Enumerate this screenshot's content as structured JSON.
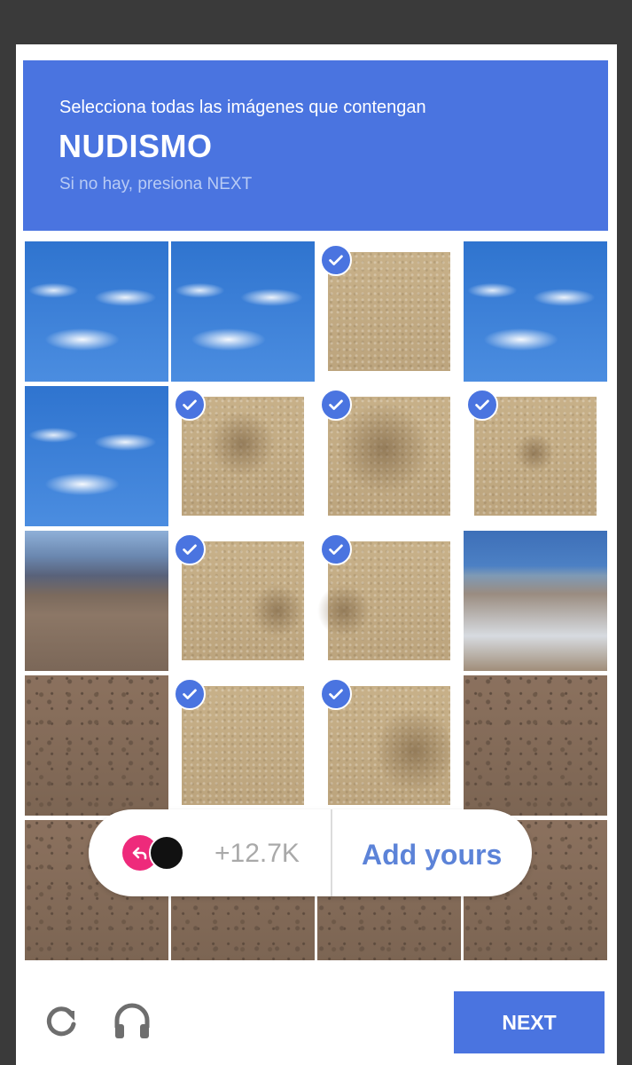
{
  "header": {
    "instruction": "Selecciona todas las imágenes que contengan",
    "keyword": "NUDISMO",
    "hint": "Si no hay, presiona NEXT"
  },
  "grid": {
    "selected_tiles": [
      3,
      6,
      7,
      8,
      10,
      11,
      14,
      15
    ]
  },
  "overlay": {
    "count": "+12.7K",
    "action_label": "Add yours"
  },
  "footer": {
    "reload_icon": "reload-icon",
    "audio_icon": "headphones-icon",
    "next_label": "NEXT"
  },
  "colors": {
    "accent": "#4a74e0",
    "reply_badge": "#ee2a7b"
  }
}
